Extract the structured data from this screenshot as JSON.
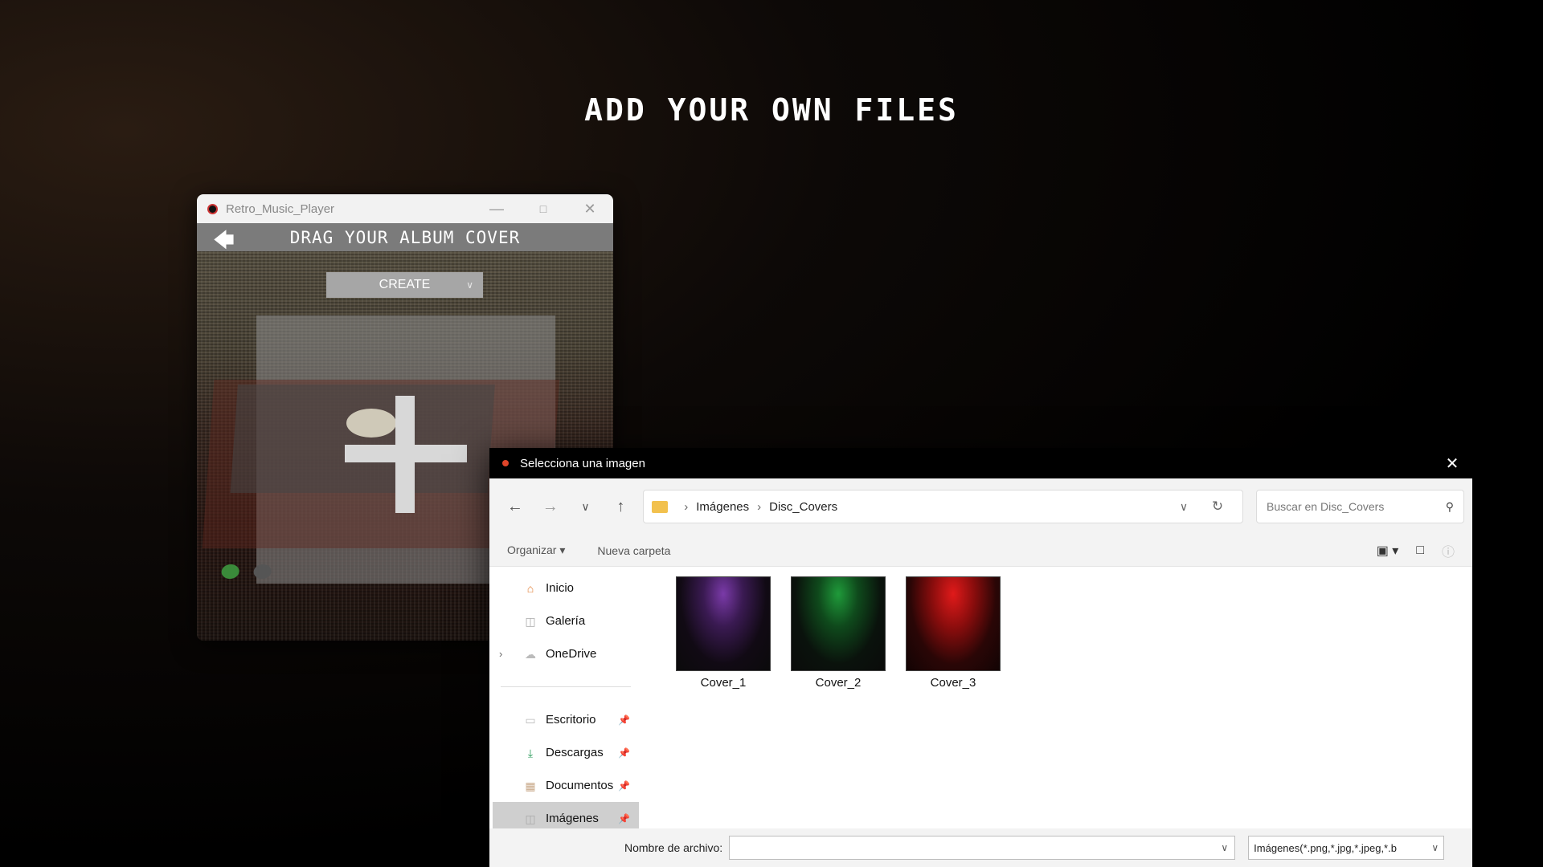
{
  "headline": "ADD YOUR OWN FILES",
  "player": {
    "window_title": "Retro_Music_Player",
    "header_title": "DRAG YOUR ALBUM COVER",
    "create_label": "CREATE",
    "icons": {
      "app": "record-icon",
      "back": "arrow-left-icon",
      "plus": "plus-icon"
    }
  },
  "dialog": {
    "title": "Selecciona una imagen",
    "breadcrumb": [
      "Imágenes",
      "Disc_Covers"
    ],
    "search_placeholder": "Buscar en Disc_Covers",
    "organize_label": "Organizar",
    "new_folder_label": "Nueva carpeta",
    "nav_items_top": [
      {
        "label": "Inicio",
        "icon": "home-icon"
      },
      {
        "label": "Galería",
        "icon": "gallery-icon"
      },
      {
        "label": "OneDrive",
        "icon": "cloud-icon"
      }
    ],
    "nav_items_quick": [
      {
        "label": "Escritorio",
        "icon": "desktop-icon"
      },
      {
        "label": "Descargas",
        "icon": "download-icon"
      },
      {
        "label": "Documentos",
        "icon": "documents-icon"
      },
      {
        "label": "Imágenes",
        "icon": "images-icon"
      }
    ],
    "files": [
      {
        "name": "Cover_1",
        "color": "#7a3aa8"
      },
      {
        "name": "Cover_2",
        "color": "#1f9a3a"
      },
      {
        "name": "Cover_3",
        "color": "#d01818"
      }
    ],
    "filename_label": "Nombre de archivo:",
    "filename_value": "",
    "filetype_value": "Imágenes(*.png,*.jpg,*.jpeg,*.b"
  }
}
